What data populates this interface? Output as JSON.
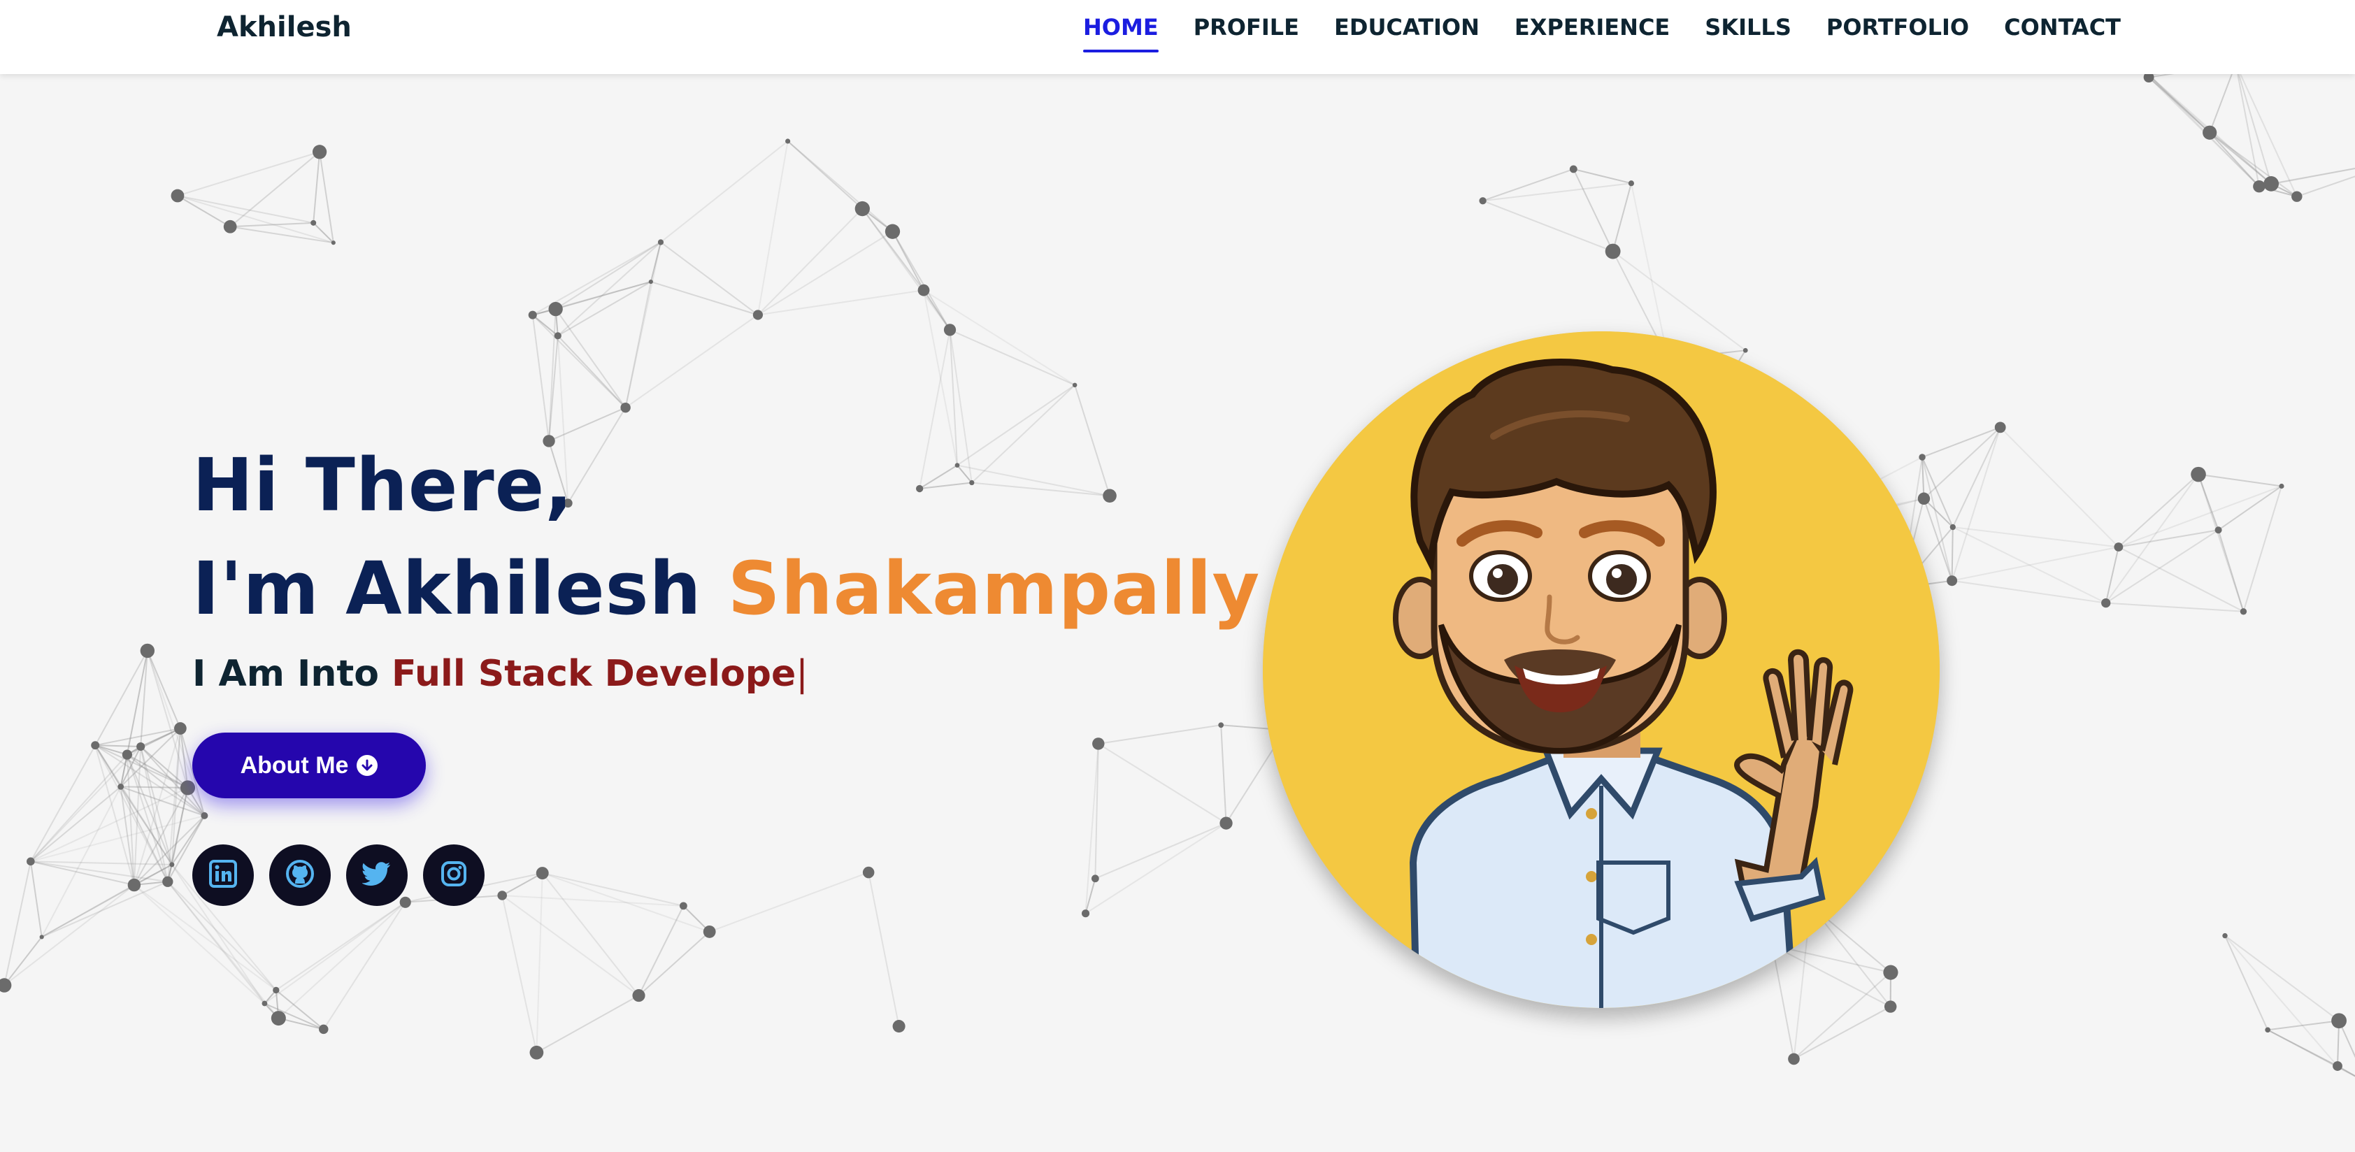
{
  "brand": "Akhilesh",
  "nav": {
    "items": [
      {
        "label": "HOME",
        "active": true
      },
      {
        "label": "PROFILE",
        "active": false
      },
      {
        "label": "EDUCATION",
        "active": false
      },
      {
        "label": "EXPERIENCE",
        "active": false
      },
      {
        "label": "SKILLS",
        "active": false
      },
      {
        "label": "PORTFOLIO",
        "active": false
      },
      {
        "label": "CONTACT",
        "active": false
      }
    ]
  },
  "hero": {
    "greeting_line1": "Hi There,",
    "greeting_prefix": "I'm Akhilesh",
    "greeting_accent": "Shakampally",
    "typed_prefix": "I Am Into",
    "typed_role": "Full Stack Develope",
    "typed_cursor": "|",
    "about_button": "About Me"
  },
  "socials": [
    {
      "icon": "linkedin-icon"
    },
    {
      "icon": "github-icon"
    },
    {
      "icon": "twitter-icon"
    },
    {
      "icon": "instagram-icon"
    }
  ],
  "colors": {
    "heading": "#0b2155",
    "accent": "#ee8a32",
    "role": "#8b1a1a",
    "nav_active": "#1b1de0",
    "button": "#2506ad",
    "social_bg": "#0e0e22",
    "social_icon": "#55b4f0",
    "avatar_bg": "#f4c842"
  }
}
